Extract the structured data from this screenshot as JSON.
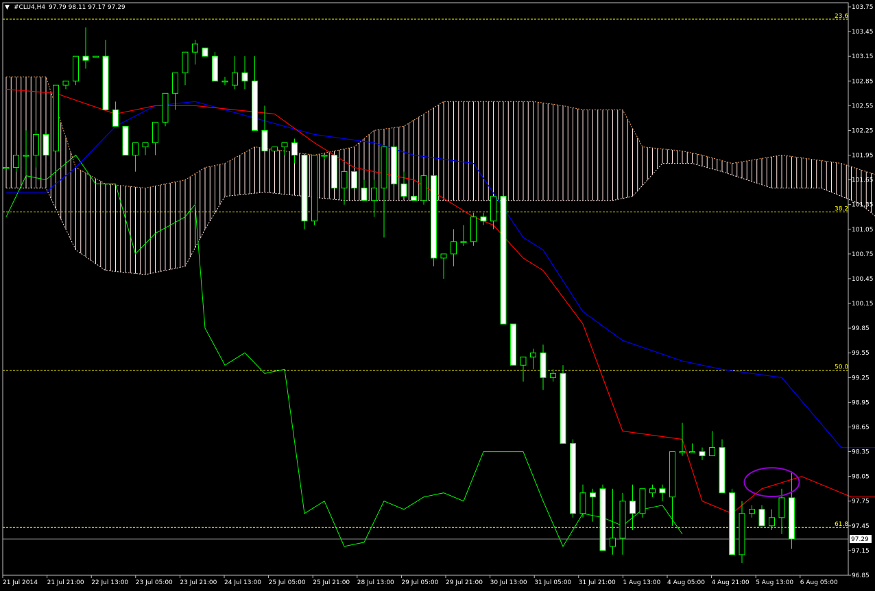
{
  "header": {
    "symbol": "#CLU4,H4",
    "ohlc": "97.79 98.11 97.17 97.29",
    "menu_glyph": "▼"
  },
  "colors": {
    "bg": "#000000",
    "axis": "#c0c0c0",
    "text": "#ffffff",
    "bull": "#00ff00",
    "bear_body": "#ffffff",
    "tenkan": "#ff0000",
    "kijun": "#0000ff",
    "chikou": "#00ff00",
    "cloud_bull": "#f4a460",
    "cloud_bear": "#ffe4e1",
    "fib": "#ffff00",
    "ellipse": "#9400d3"
  },
  "chart_data": {
    "type": "candlestick",
    "y_axis": {
      "min": 96.85,
      "max": 103.75,
      "ticks": [
        "103.75",
        "103.45",
        "103.15",
        "102.85",
        "102.55",
        "102.25",
        "101.95",
        "101.65",
        "101.35",
        "101.05",
        "100.75",
        "100.45",
        "100.15",
        "99.85",
        "99.55",
        "99.25",
        "98.95",
        "98.65",
        "98.35",
        "98.05",
        "97.75",
        "97.45",
        "97.15",
        "96.85"
      ],
      "current_price": "97.29"
    },
    "x_axis": {
      "labels": [
        "21 Jul 2014",
        "21 Jul 21:00",
        "22 Jul 13:00",
        "23 Jul 05:00",
        "23 Jul 21:00",
        "24 Jul 13:00",
        "25 Jul 05:00",
        "25 Jul 21:00",
        "28 Jul 13:00",
        "29 Jul 05:00",
        "29 Jul 21:00",
        "30 Jul 13:00",
        "31 Jul 05:00",
        "31 Jul 21:00",
        "1 Aug 13:00",
        "4 Aug 05:00",
        "4 Aug 21:00",
        "5 Aug 13:00",
        "6 Aug 05:00"
      ]
    },
    "fib_levels": [
      {
        "label": "23.6",
        "value": 103.6
      },
      {
        "label": "38.2",
        "value": 101.26
      },
      {
        "label": "50.0",
        "value": 99.34
      },
      {
        "label": "61.8",
        "value": 97.43
      }
    ],
    "candles": [
      [
        101.8,
        101.8,
        101.8,
        101.8
      ],
      [
        101.8,
        101.95,
        101.75,
        101.95
      ],
      [
        101.95,
        102.25,
        101.7,
        101.95
      ],
      [
        101.95,
        102.25,
        101.8,
        102.2
      ],
      [
        102.2,
        102.2,
        101.95,
        101.95
      ],
      [
        102.0,
        102.8,
        102.0,
        102.8
      ],
      [
        102.8,
        102.85,
        102.75,
        102.85
      ],
      [
        102.85,
        103.15,
        102.8,
        103.15
      ],
      [
        103.15,
        103.5,
        103.0,
        103.1
      ],
      [
        103.15,
        103.15,
        103.15,
        103.15
      ],
      [
        103.15,
        103.35,
        102.5,
        102.5
      ],
      [
        102.5,
        102.6,
        102.3,
        102.3
      ],
      [
        102.3,
        102.3,
        101.95,
        101.95
      ],
      [
        101.95,
        102.1,
        101.75,
        102.1
      ],
      [
        102.05,
        102.1,
        101.95,
        102.1
      ],
      [
        102.1,
        102.35,
        101.95,
        102.35
      ],
      [
        102.35,
        102.6,
        102.3,
        102.7
      ],
      [
        102.7,
        102.8,
        102.5,
        102.95
      ],
      [
        102.95,
        103.2,
        102.8,
        103.2
      ],
      [
        103.2,
        103.35,
        103.05,
        103.3
      ],
      [
        103.25,
        103.25,
        103.15,
        103.15
      ],
      [
        103.15,
        103.2,
        102.85,
        102.85
      ],
      [
        102.85,
        102.9,
        102.8,
        102.85
      ],
      [
        102.8,
        103.15,
        102.75,
        102.95
      ],
      [
        102.95,
        103.15,
        102.75,
        102.85
      ],
      [
        102.85,
        103.15,
        102.35,
        102.25
      ],
      [
        102.25,
        102.55,
        102.0,
        102.0
      ],
      [
        102.0,
        102.05,
        102.0,
        102.05
      ],
      [
        102.05,
        102.1,
        101.95,
        102.1
      ],
      [
        102.1,
        102.15,
        101.85,
        101.95
      ],
      [
        101.95,
        101.95,
        101.05,
        101.15
      ],
      [
        101.15,
        101.95,
        101.1,
        101.95
      ],
      [
        101.95,
        101.95,
        101.9,
        101.95
      ],
      [
        101.95,
        101.95,
        101.55,
        101.55
      ],
      [
        101.55,
        101.75,
        101.35,
        101.75
      ],
      [
        101.75,
        101.75,
        101.55,
        101.55
      ],
      [
        101.55,
        101.65,
        101.4,
        101.4
      ],
      [
        101.4,
        101.65,
        101.2,
        101.55
      ],
      [
        101.55,
        102.0,
        100.95,
        102.05
      ],
      [
        102.05,
        102.05,
        101.6,
        101.6
      ],
      [
        101.6,
        101.75,
        101.45,
        101.45
      ],
      [
        101.45,
        101.45,
        101.4,
        101.4
      ],
      [
        101.4,
        101.7,
        101.35,
        101.7
      ],
      [
        101.7,
        101.7,
        100.6,
        100.7
      ],
      [
        100.7,
        100.75,
        100.45,
        100.75
      ],
      [
        100.75,
        101.05,
        100.6,
        100.9
      ],
      [
        100.9,
        101.1,
        100.85,
        100.9
      ],
      [
        100.9,
        101.25,
        100.85,
        101.2
      ],
      [
        101.2,
        101.25,
        101.1,
        101.15
      ],
      [
        101.15,
        101.45,
        101.05,
        101.45
      ],
      [
        101.45,
        101.45,
        99.9,
        99.9
      ],
      [
        99.9,
        99.9,
        99.4,
        99.4
      ],
      [
        99.4,
        99.5,
        99.2,
        99.5
      ],
      [
        99.5,
        99.6,
        99.35,
        99.55
      ],
      [
        99.55,
        99.65,
        99.1,
        99.25
      ],
      [
        99.25,
        99.35,
        99.2,
        99.3
      ],
      [
        99.3,
        99.4,
        98.5,
        98.45
      ],
      [
        98.45,
        98.5,
        97.55,
        97.6
      ],
      [
        97.6,
        97.95,
        97.55,
        97.85
      ],
      [
        97.85,
        97.9,
        97.5,
        97.8
      ],
      [
        97.9,
        97.95,
        97.15,
        97.15
      ],
      [
        97.2,
        97.9,
        97.1,
        97.3
      ],
      [
        97.3,
        97.85,
        97.1,
        97.75
      ],
      [
        97.75,
        97.95,
        97.4,
        97.6
      ],
      [
        97.6,
        97.9,
        97.55,
        97.9
      ],
      [
        97.85,
        97.95,
        97.8,
        97.9
      ],
      [
        97.9,
        97.95,
        97.75,
        97.85
      ],
      [
        97.8,
        98.35,
        97.45,
        98.35
      ],
      [
        98.35,
        98.7,
        98.3,
        98.35
      ],
      [
        98.35,
        98.45,
        98.35,
        98.35
      ],
      [
        98.35,
        98.4,
        98.25,
        98.3
      ],
      [
        98.3,
        98.6,
        98.3,
        98.4
      ],
      [
        98.4,
        98.5,
        97.85,
        97.85
      ],
      [
        97.85,
        97.9,
        97.1,
        97.1
      ],
      [
        97.1,
        97.75,
        97.0,
        97.6
      ],
      [
        97.6,
        97.7,
        97.55,
        97.65
      ],
      [
        97.65,
        97.7,
        97.45,
        97.45
      ],
      [
        97.45,
        97.65,
        97.4,
        97.55
      ],
      [
        97.55,
        97.9,
        97.35,
        97.79
      ],
      [
        97.79,
        98.11,
        97.17,
        97.29
      ]
    ],
    "tenkan": [
      [
        0,
        102.75
      ],
      [
        5,
        102.7
      ],
      [
        11,
        102.45
      ],
      [
        15,
        102.55
      ],
      [
        19,
        102.55
      ],
      [
        27,
        102.45
      ],
      [
        31,
        102.1
      ],
      [
        35,
        101.8
      ],
      [
        41,
        101.65
      ],
      [
        47,
        101.2
      ],
      [
        49,
        101.1
      ],
      [
        52,
        100.7
      ],
      [
        54,
        100.55
      ],
      [
        58,
        99.9
      ],
      [
        62,
        98.6
      ],
      [
        68,
        98.5
      ],
      [
        70,
        97.75
      ],
      [
        73,
        97.6
      ],
      [
        76,
        97.9
      ],
      [
        80,
        98.05
      ],
      [
        85,
        97.8
      ],
      [
        90,
        97.8
      ]
    ],
    "kijun": [
      [
        0,
        101.5
      ],
      [
        4,
        101.5
      ],
      [
        7,
        101.8
      ],
      [
        11,
        102.3
      ],
      [
        15,
        102.55
      ],
      [
        19,
        102.6
      ],
      [
        25,
        102.4
      ],
      [
        31,
        102.2
      ],
      [
        37,
        102.1
      ],
      [
        41,
        101.95
      ],
      [
        47,
        101.85
      ],
      [
        52,
        100.95
      ],
      [
        54,
        100.8
      ],
      [
        58,
        100.05
      ],
      [
        62,
        99.7
      ],
      [
        68,
        99.45
      ],
      [
        72,
        99.35
      ],
      [
        78,
        99.25
      ],
      [
        84,
        98.4
      ],
      [
        89,
        98.4
      ]
    ],
    "chikou": [
      [
        0,
        101.2
      ],
      [
        2,
        101.7
      ],
      [
        4,
        101.65
      ],
      [
        7,
        101.95
      ],
      [
        9,
        101.6
      ],
      [
        11,
        101.6
      ],
      [
        13,
        100.75
      ],
      [
        15,
        101.0
      ],
      [
        18,
        101.2
      ],
      [
        19,
        101.35
      ],
      [
        20,
        99.85
      ],
      [
        22,
        99.4
      ],
      [
        24,
        99.55
      ],
      [
        26,
        99.3
      ],
      [
        28,
        99.35
      ],
      [
        30,
        97.6
      ],
      [
        32,
        97.75
      ],
      [
        34,
        97.2
      ],
      [
        36,
        97.25
      ],
      [
        38,
        97.75
      ],
      [
        40,
        97.65
      ],
      [
        42,
        97.8
      ],
      [
        44,
        97.85
      ],
      [
        46,
        97.75
      ],
      [
        48,
        98.35
      ],
      [
        50,
        98.35
      ],
      [
        52,
        98.35
      ],
      [
        54,
        97.75
      ],
      [
        56,
        97.2
      ],
      [
        58,
        97.6
      ],
      [
        60,
        97.55
      ],
      [
        62,
        97.45
      ],
      [
        64,
        97.65
      ],
      [
        66,
        97.7
      ],
      [
        68,
        97.35
      ]
    ],
    "cloud_spanA": [
      [
        0,
        102.9
      ],
      [
        4,
        102.9
      ],
      [
        7,
        101.8
      ],
      [
        10,
        101.6
      ],
      [
        14,
        101.55
      ],
      [
        18,
        101.65
      ],
      [
        20,
        101.8
      ],
      [
        22,
        101.85
      ],
      [
        25,
        102.05
      ],
      [
        31,
        101.95
      ],
      [
        35,
        102.05
      ],
      [
        37,
        102.25
      ],
      [
        40,
        102.3
      ],
      [
        42,
        102.45
      ],
      [
        44,
        102.6
      ],
      [
        49,
        102.6
      ],
      [
        53,
        102.6
      ],
      [
        56,
        102.55
      ],
      [
        58,
        102.5
      ],
      [
        62,
        102.5
      ],
      [
        64,
        102.05
      ],
      [
        68,
        102.0
      ],
      [
        70,
        101.95
      ],
      [
        73,
        101.85
      ],
      [
        78,
        101.95
      ],
      [
        84,
        101.85
      ],
      [
        89,
        101.65
      ],
      [
        94,
        101.3
      ],
      [
        97,
        100.8
      ]
    ],
    "cloud_spanB": [
      [
        0,
        101.55
      ],
      [
        4,
        101.55
      ],
      [
        7,
        100.8
      ],
      [
        10,
        100.55
      ],
      [
        14,
        100.5
      ],
      [
        18,
        100.6
      ],
      [
        20,
        101.05
      ],
      [
        22,
        101.45
      ],
      [
        26,
        101.5
      ],
      [
        34,
        101.4
      ],
      [
        40,
        101.4
      ],
      [
        49,
        101.4
      ],
      [
        57,
        101.4
      ],
      [
        61,
        101.4
      ],
      [
        63,
        101.45
      ],
      [
        66,
        101.85
      ],
      [
        69,
        101.85
      ],
      [
        72,
        101.75
      ],
      [
        77,
        101.55
      ],
      [
        82,
        101.55
      ],
      [
        86,
        101.35
      ],
      [
        90,
        100.95
      ],
      [
        92,
        100.6
      ],
      [
        94,
        100.5
      ]
    ],
    "annotation": {
      "type": "ellipse",
      "candle_index": 77,
      "price": 97.98
    }
  }
}
